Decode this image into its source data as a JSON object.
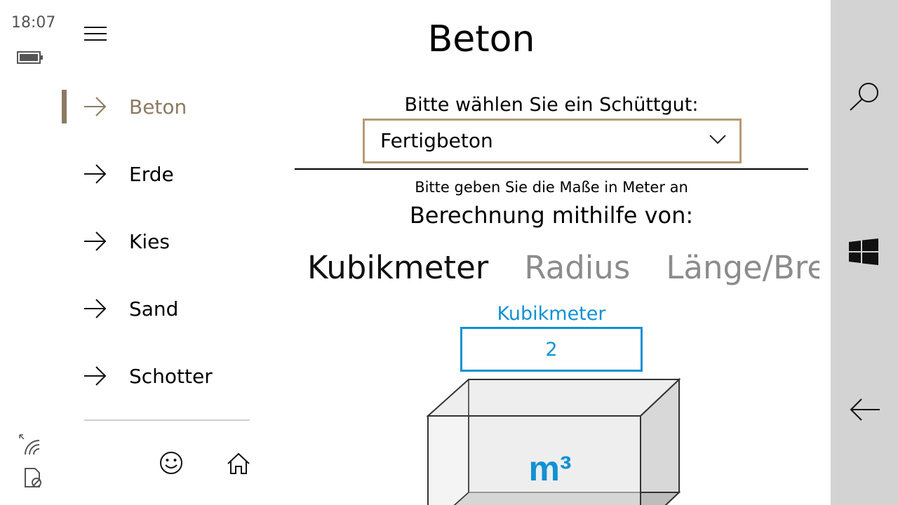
{
  "status": {
    "time": "18:07",
    "icons": [
      "battery-icon",
      "wifi-signal-icon",
      "no-sim-icon"
    ]
  },
  "nav": {
    "menu_icon": "hamburger-icon",
    "items": [
      {
        "label": "Beton",
        "icon": "arrow-right-icon",
        "selected": true
      },
      {
        "label": "Erde",
        "icon": "arrow-right-icon",
        "selected": false
      },
      {
        "label": "Kies",
        "icon": "arrow-right-icon",
        "selected": false
      },
      {
        "label": "Sand",
        "icon": "arrow-right-icon",
        "selected": false
      },
      {
        "label": "Schotter",
        "icon": "arrow-right-icon",
        "selected": false
      }
    ],
    "bottom_icons": [
      "smiley-icon",
      "home-icon"
    ]
  },
  "main": {
    "title": "Beton",
    "prompt": "Bitte wählen Sie ein Schüttgut:",
    "dropdown": {
      "selected": "Fertigbeton"
    },
    "hint": "Bitte geben Sie die Maße in Meter an",
    "calc_title": "Berechnung mithilfe von:",
    "pivot_tabs": [
      {
        "label": "Kubikmeter",
        "active": true
      },
      {
        "label": "Radius",
        "active": false
      },
      {
        "label": "Länge/Breite",
        "active": false
      }
    ],
    "field": {
      "label": "Kubikmeter",
      "value": "2"
    },
    "cube_label": "m³"
  },
  "system_bar": {
    "icons": [
      "search-icon",
      "windows-logo-icon",
      "back-arrow-icon"
    ]
  },
  "colors": {
    "accent": "#8a7b62",
    "dropdown_border": "#b89a72",
    "input_accent": "#1191d4",
    "system_bar": "#d3d3d3"
  }
}
